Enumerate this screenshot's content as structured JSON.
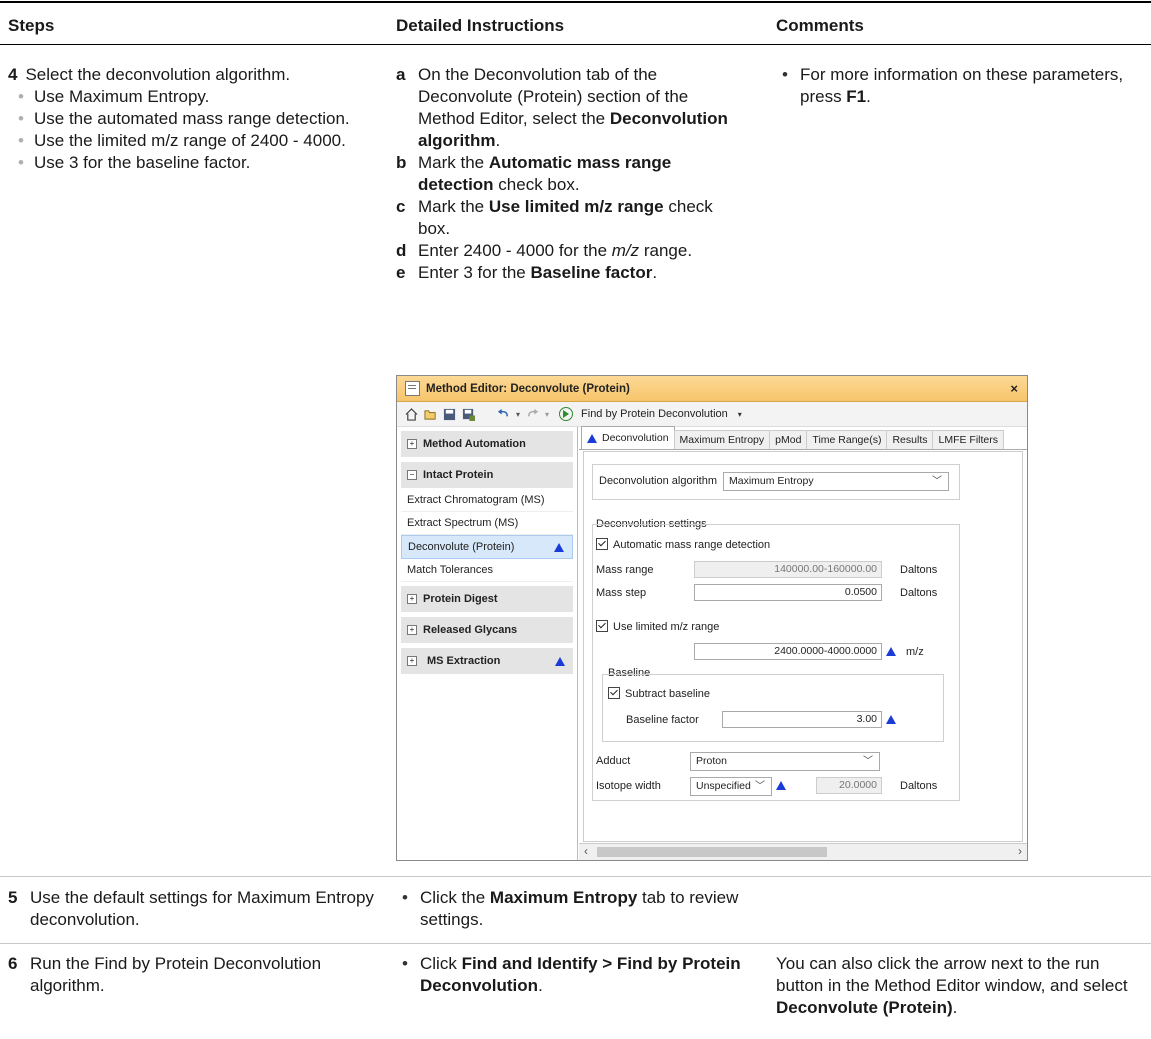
{
  "headers": {
    "steps": "Steps",
    "instructions": "Detailed Instructions",
    "comments": "Comments"
  },
  "step4": {
    "num": "4",
    "title": "Select the deconvolution algorithm.",
    "bullets": [
      "Use Maximum Entropy.",
      "Use the automated mass range detection.",
      "Use the limited m/z range of 2400 - 4000.",
      "Use 3 for the baseline factor."
    ],
    "a_1": "On the Deconvolution tab of the Deconvolute (Protein) section of the Method Editor, select the ",
    "a_b": "Deconvolution algorithm",
    "a_2": ".",
    "b_1": "Mark the ",
    "b_b": "Automatic mass range detection",
    "b_2": " check box.",
    "c_1": "Mark the ",
    "c_b": "Use limited m/z range",
    "c_2": " check box.",
    "d_1": "Enter 2400 - 4000 for the ",
    "d_i": "m/z",
    "d_2": " range.",
    "e_1": "Enter 3 for the ",
    "e_b": "Baseline factor",
    "e_2": ".",
    "comment_1": "For more information on these parameters, press ",
    "comment_b": "F1",
    "comment_2": "."
  },
  "window": {
    "title": "Method Editor: Deconvolute (Protein)",
    "close": "×",
    "run_label": "Find by Protein Deconvolution",
    "nav": {
      "method_automation": "Method Automation",
      "intact_protein": "Intact Protein",
      "items": [
        "Extract Chromatogram (MS)",
        "Extract Spectrum (MS)",
        "Deconvolute (Protein)",
        "Match Tolerances"
      ],
      "protein_digest": "Protein Digest",
      "released_glycans": "Released Glycans",
      "ms_extraction": "MS Extraction"
    },
    "tabs": [
      "Deconvolution",
      "Maximum Entropy",
      "pMod",
      "Time Range(s)",
      "Results",
      "LMFE Filters"
    ],
    "algo_label": "Deconvolution algorithm",
    "algo_value": "Maximum Entropy",
    "settings_label": "Deconvolution settings",
    "auto_mass_label": "Automatic mass range detection",
    "mass_range_label": "Mass range",
    "mass_range_value": "140000.00-160000.00",
    "mass_step_label": "Mass step",
    "mass_step_value": "0.0500",
    "daltons": "Daltons",
    "use_limited_label": "Use limited m/z range",
    "mz_value": "2400.0000-4000.0000",
    "mz_unit": "m/z",
    "baseline_group": "Baseline",
    "subtract_label": "Subtract baseline",
    "baseline_factor_label": "Baseline factor",
    "baseline_factor_value": "3.00",
    "adduct_label": "Adduct",
    "adduct_value": "Proton",
    "isotope_label": "Isotope width",
    "isotope_value": "Unspecified",
    "isotope_num": "20.0000"
  },
  "step5": {
    "num": "5",
    "title": "Use the default settings for Maximum Entropy deconvolution.",
    "i_1": "Click the ",
    "i_b": "Maximum Entropy",
    "i_2": " tab to review settings."
  },
  "step6": {
    "num": "6",
    "title": "Run the Find by Protein Deconvolution algorithm.",
    "i_1": "Click ",
    "i_b": "Find and Identify > Find by Protein Deconvolution",
    "i_2": ".",
    "comment_1": "You can also click the arrow next to the run button in the Method Editor window, and select ",
    "comment_b": "Deconvolute (Protein)",
    "comment_2": "."
  }
}
